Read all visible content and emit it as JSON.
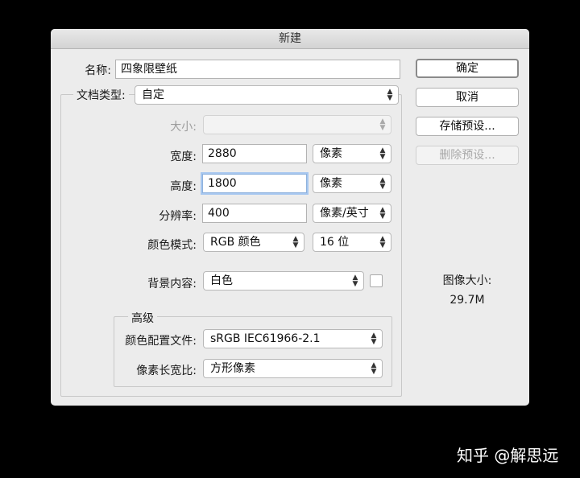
{
  "dialog": {
    "title": "新建",
    "name": {
      "label": "名称:",
      "value": "四象限壁纸"
    },
    "doc_type": {
      "label": "文档类型:",
      "value": "自定"
    },
    "size": {
      "label": "大小:",
      "value": ""
    },
    "width": {
      "label": "宽度:",
      "value": "2880",
      "unit": "像素"
    },
    "height": {
      "label": "高度:",
      "value": "1800",
      "unit": "像素"
    },
    "resolution": {
      "label": "分辨率:",
      "value": "400",
      "unit": "像素/英寸"
    },
    "color_mode": {
      "label": "颜色模式:",
      "value": "RGB 颜色",
      "depth": "16 位"
    },
    "background": {
      "label": "背景内容:",
      "value": "白色",
      "swatch_color": "#ffffff"
    },
    "advanced": {
      "title": "高级",
      "color_profile": {
        "label": "颜色配置文件:",
        "value": "sRGB IEC61966-2.1"
      },
      "pixel_aspect": {
        "label": "像素长宽比:",
        "value": "方形像素"
      }
    },
    "buttons": {
      "ok": "确定",
      "cancel": "取消",
      "save_preset": "存储预设...",
      "delete_preset": "删除预设..."
    },
    "image_size": {
      "label": "图像大小:",
      "value": "29.7M"
    }
  },
  "watermark": "知乎 @解思远"
}
